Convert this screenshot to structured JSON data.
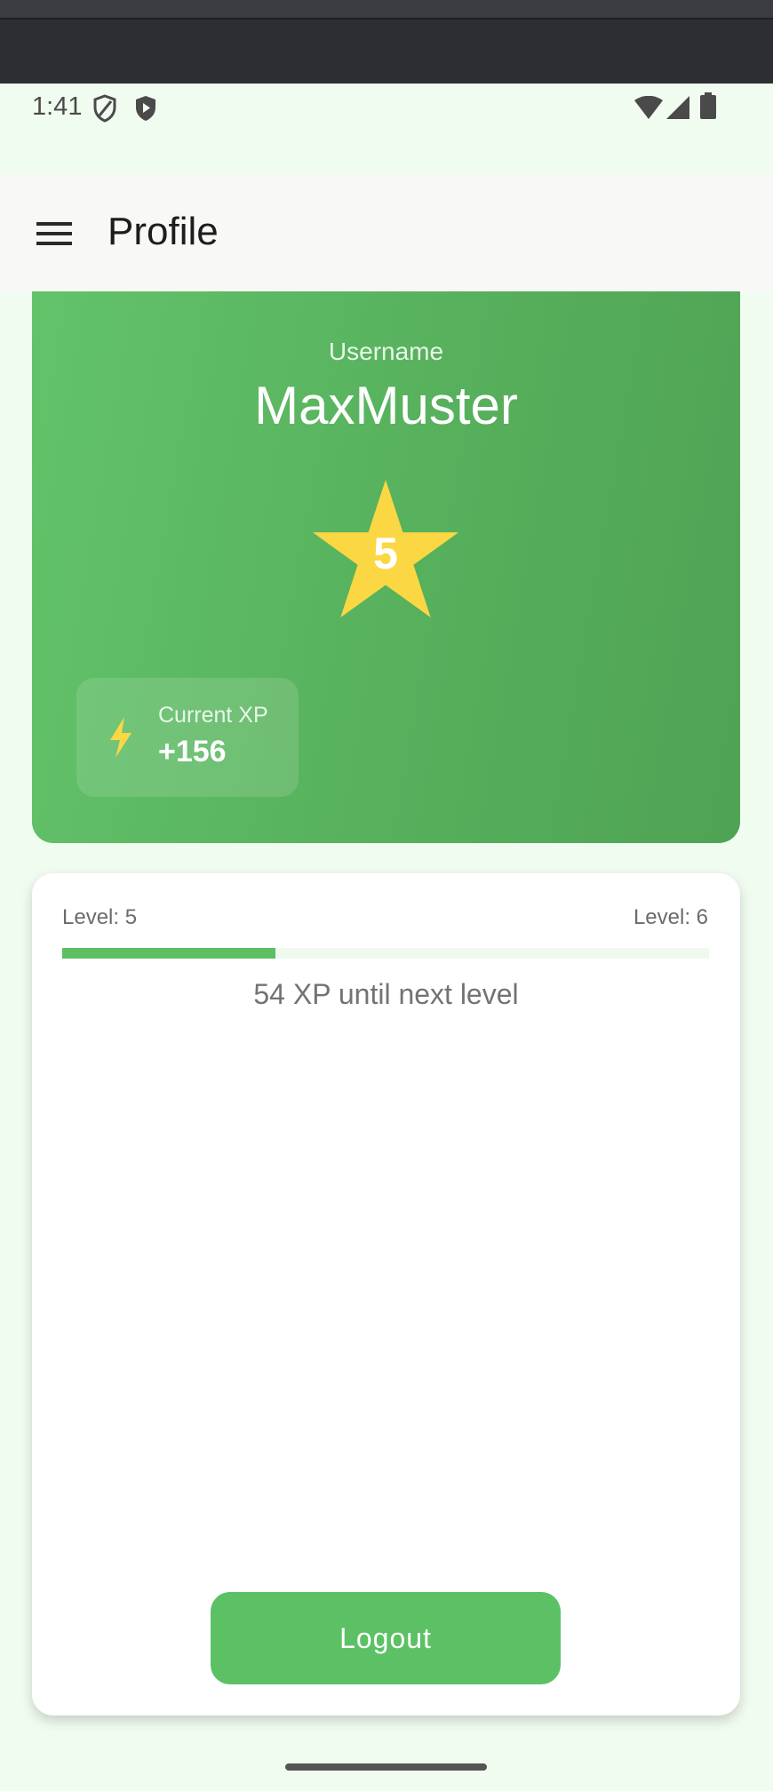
{
  "status_bar": {
    "time": "1:41",
    "left_icons": [
      "shield-outline-icon",
      "shield-play-icon"
    ],
    "right_icons": [
      "wifi-icon",
      "signal-icon",
      "battery-icon"
    ]
  },
  "app_bar": {
    "menu_icon": "hamburger-menu-icon",
    "title": "Profile"
  },
  "profile": {
    "username_label": "Username",
    "username": "MaxMuster",
    "level": "5",
    "xp_label": "Current XP",
    "xp_value": "+156",
    "xp_icon": "lightning-bolt-icon"
  },
  "progress": {
    "current_level_label": "Level: 5",
    "next_level_label": "Level: 6",
    "fraction": 0.33,
    "xp_until_text": "54 XP until next level"
  },
  "actions": {
    "logout_label": "Logout"
  },
  "colors": {
    "accent_green": "#5cc165",
    "star_yellow": "#fcd744",
    "page_background": "#f1fcf0"
  }
}
